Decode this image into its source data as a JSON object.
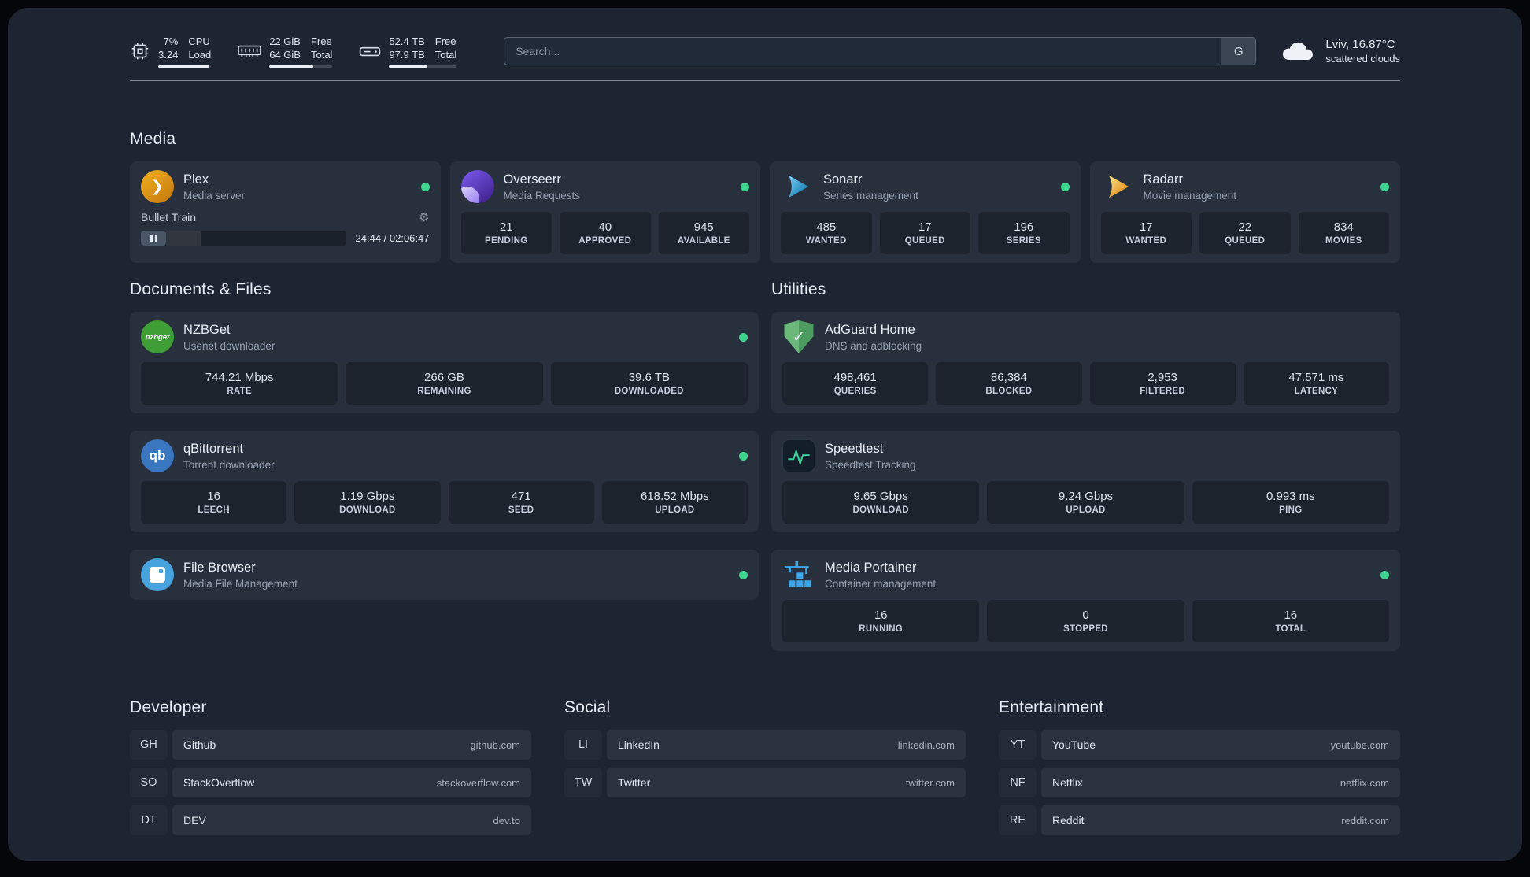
{
  "header": {
    "cpu": {
      "value_top": "7%",
      "value_bottom": "3.24",
      "label_top": "CPU",
      "label_bottom": "Load"
    },
    "memory": {
      "value_top": "22 GiB",
      "value_bottom": "64 GiB",
      "label_top": "Free",
      "label_bottom": "Total"
    },
    "disk": {
      "value_top": "52.4 TB",
      "value_bottom": "97.9 TB",
      "label_top": "Free",
      "label_bottom": "Total"
    },
    "search": {
      "placeholder": "Search...",
      "provider": "G"
    },
    "weather": {
      "location": "Lviv, 16.87°C",
      "condition": "scattered clouds"
    }
  },
  "groups": {
    "media": {
      "title": "Media",
      "plex": {
        "name": "Plex",
        "desc": "Media server",
        "now_playing": "Bullet Train",
        "time": "24:44 / 02:06:47"
      },
      "overseerr": {
        "name": "Overseerr",
        "desc": "Media Requests",
        "stats": [
          {
            "value": "21",
            "label": "PENDING"
          },
          {
            "value": "40",
            "label": "APPROVED"
          },
          {
            "value": "945",
            "label": "AVAILABLE"
          }
        ]
      },
      "sonarr": {
        "name": "Sonarr",
        "desc": "Series management",
        "stats": [
          {
            "value": "485",
            "label": "WANTED"
          },
          {
            "value": "17",
            "label": "QUEUED"
          },
          {
            "value": "196",
            "label": "SERIES"
          }
        ]
      },
      "radarr": {
        "name": "Radarr",
        "desc": "Movie management",
        "stats": [
          {
            "value": "17",
            "label": "WANTED"
          },
          {
            "value": "22",
            "label": "QUEUED"
          },
          {
            "value": "834",
            "label": "MOVIES"
          }
        ]
      }
    },
    "documents": {
      "title": "Documents & Files",
      "nzbget": {
        "name": "NZBGet",
        "desc": "Usenet downloader",
        "stats": [
          {
            "value": "744.21 Mbps",
            "label": "RATE"
          },
          {
            "value": "266 GB",
            "label": "REMAINING"
          },
          {
            "value": "39.6 TB",
            "label": "DOWNLOADED"
          }
        ]
      },
      "qbittorrent": {
        "name": "qBittorrent",
        "desc": "Torrent downloader",
        "stats": [
          {
            "value": "16",
            "label": "LEECH"
          },
          {
            "value": "1.19 Gbps",
            "label": "DOWNLOAD"
          },
          {
            "value": "471",
            "label": "SEED"
          },
          {
            "value": "618.52 Mbps",
            "label": "UPLOAD"
          }
        ]
      },
      "filebrowser": {
        "name": "File Browser",
        "desc": "Media File Management"
      }
    },
    "utilities": {
      "title": "Utilities",
      "adguard": {
        "name": "AdGuard Home",
        "desc": "DNS and adblocking",
        "stats": [
          {
            "value": "498,461",
            "label": "QUERIES"
          },
          {
            "value": "86,384",
            "label": "BLOCKED"
          },
          {
            "value": "2,953",
            "label": "FILTERED"
          },
          {
            "value": "47.571 ms",
            "label": "LATENCY"
          }
        ]
      },
      "speedtest": {
        "name": "Speedtest",
        "desc": "Speedtest Tracking",
        "stats": [
          {
            "value": "9.65 Gbps",
            "label": "DOWNLOAD"
          },
          {
            "value": "9.24 Gbps",
            "label": "UPLOAD"
          },
          {
            "value": "0.993 ms",
            "label": "PING"
          }
        ]
      },
      "portainer": {
        "name": "Media Portainer",
        "desc": "Container management",
        "stats": [
          {
            "value": "16",
            "label": "RUNNING"
          },
          {
            "value": "0",
            "label": "STOPPED"
          },
          {
            "value": "16",
            "label": "TOTAL"
          }
        ]
      }
    }
  },
  "bookmarks": {
    "developer": {
      "title": "Developer",
      "items": [
        {
          "abbr": "GH",
          "name": "Github",
          "url": "github.com"
        },
        {
          "abbr": "SO",
          "name": "StackOverflow",
          "url": "stackoverflow.com"
        },
        {
          "abbr": "DT",
          "name": "DEV",
          "url": "dev.to"
        }
      ]
    },
    "social": {
      "title": "Social",
      "items": [
        {
          "abbr": "LI",
          "name": "LinkedIn",
          "url": "linkedin.com"
        },
        {
          "abbr": "TW",
          "name": "Twitter",
          "url": "twitter.com"
        }
      ]
    },
    "entertainment": {
      "title": "Entertainment",
      "items": [
        {
          "abbr": "YT",
          "name": "YouTube",
          "url": "youtube.com"
        },
        {
          "abbr": "NF",
          "name": "Netflix",
          "url": "netflix.com"
        },
        {
          "abbr": "RE",
          "name": "Reddit",
          "url": "reddit.com"
        }
      ]
    }
  },
  "icons": {
    "plex_chevron": "❯",
    "gear": "⚙",
    "check": "✓",
    "qbittorrent_text": "qb",
    "nzbget_text": "nzbget"
  }
}
